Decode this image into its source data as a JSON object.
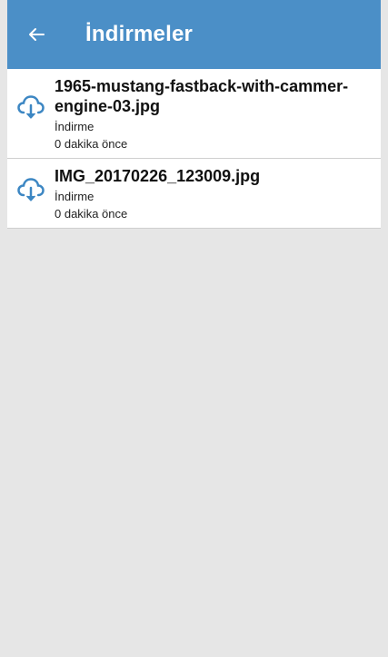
{
  "app_bar": {
    "title": "İndirmeler",
    "back_icon": "arrow-left-icon",
    "color": "#4b8fc7"
  },
  "downloads": [
    {
      "file_name": "1965-mustang-fastback-with-cammer-engine-03.jpg",
      "type": "İndirme",
      "time": "0 dakika önce",
      "icon": "cloud-download-icon"
    },
    {
      "file_name": "IMG_20170226_123009.jpg",
      "type": "İndirme",
      "time": "0 dakika önce",
      "icon": "cloud-download-icon"
    }
  ],
  "icon_color": "#3d87c3"
}
